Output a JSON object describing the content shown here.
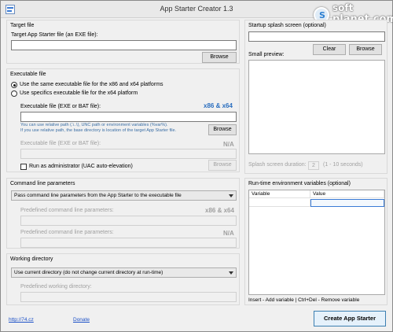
{
  "window": {
    "title": "App Starter Creator 1.3",
    "watermark_line1": "soft",
    "watermark_line2": "planet.com"
  },
  "target": {
    "group_title": "Target file",
    "label": "Target App Starter file (an EXE file):",
    "value": "",
    "browse_label": "Browse"
  },
  "executable": {
    "group_title": "Executable file",
    "radio_same_label": "Use the same executable file for the x86 and x64 platforms",
    "radio_specific_label": "Use specifics executable file for the x64 platform",
    "file_label": "Executable file (EXE or BAT file):",
    "arch_primary": "x86 & x64",
    "note_line1": "You can use relative path (.\\..\\), UNC path or environment variables (%var%).",
    "note_line2": "If you use relative path, the base directory is location of the target App Starter file.",
    "browse_label": "Browse",
    "file2_label": "Executable file (EXE or BAT file):",
    "arch_secondary": "N/A",
    "browse2_label": "Browse",
    "run_admin_label": "Run as administrator (UAC auto-elevation)"
  },
  "cmdline": {
    "group_title": "Command line parameters",
    "select_value": "Pass command line parameters from the App Starter to the executable file",
    "predef1_label": "Predefined command line parameters:",
    "predef1_arch": "x86 & x64",
    "predef2_label": "Predefined command line parameters:",
    "predef2_arch": "N/A"
  },
  "workdir": {
    "group_title": "Working directory",
    "select_value": "Use current directory (do not change current directory at run-time)",
    "predef_label": "Predefined working directory:"
  },
  "splash": {
    "group_title": "Startup splash screen (optional)",
    "clear_label": "Clear",
    "browse_label": "Browse",
    "preview_label": "Small preview:",
    "duration_label": "Splash screen duration:",
    "duration_value": "2",
    "duration_range": "(1 - 10 seconds)"
  },
  "envvars": {
    "group_title": "Run-time environment variables (optional)",
    "col_variable": "Variable",
    "col_value": "Value",
    "hint": "Insert - Add variable | Ctrl+Del - Remove variable"
  },
  "footer": {
    "site_link": "http://74.cz",
    "donate_link": "Donate",
    "create_label": "Create App Starter"
  }
}
